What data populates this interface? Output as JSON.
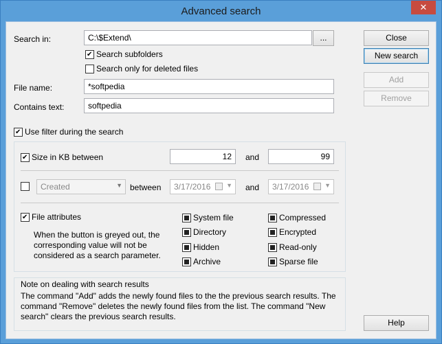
{
  "window": {
    "title": "Advanced search",
    "close_glyph": "✕"
  },
  "search_in": {
    "label": "Search in:",
    "value": "C:\\$Extend\\",
    "browse_label": "..."
  },
  "subfolders": {
    "label": "Search subfolders",
    "checked": true
  },
  "deleted_only": {
    "label": "Search only for deleted files",
    "checked": false
  },
  "file_name": {
    "label": "File name:",
    "value": "*softpedia"
  },
  "contains_text": {
    "label": "Contains text:",
    "value": "softpedia"
  },
  "use_filter": {
    "label": "Use filter during the search",
    "checked": true
  },
  "size_filter": {
    "label": "Size in KB between",
    "checked": true,
    "min": "12",
    "and_label": "and",
    "max": "99"
  },
  "date_filter": {
    "checked": false,
    "type_value": "Created",
    "between_label": "between",
    "from": "3/17/2016",
    "and_label": "and",
    "to": "3/17/2016"
  },
  "attributes": {
    "label": "File attributes",
    "checked": true,
    "note": "When the button is greyed out, the corresponding value will not be considered as a search parameter.",
    "items": [
      "System file",
      "Directory",
      "Hidden",
      "Archive",
      "Compressed",
      "Encrypted",
      "Read-only",
      "Sparse file"
    ]
  },
  "results_note": {
    "heading": "Note on dealing with search results",
    "body": "The command \"Add\" adds the newly found files to the the previous search results. The command \"Remove\" deletes the newly found files from the list. The command \"New search\" clears the previous search results."
  },
  "buttons": {
    "close": "Close",
    "new_search": "New search",
    "add": "Add",
    "remove": "Remove",
    "help": "Help"
  },
  "colors": {
    "title_bar": "#5a9fd9",
    "close_button": "#c74b3f",
    "client": "#f0f0f0"
  }
}
